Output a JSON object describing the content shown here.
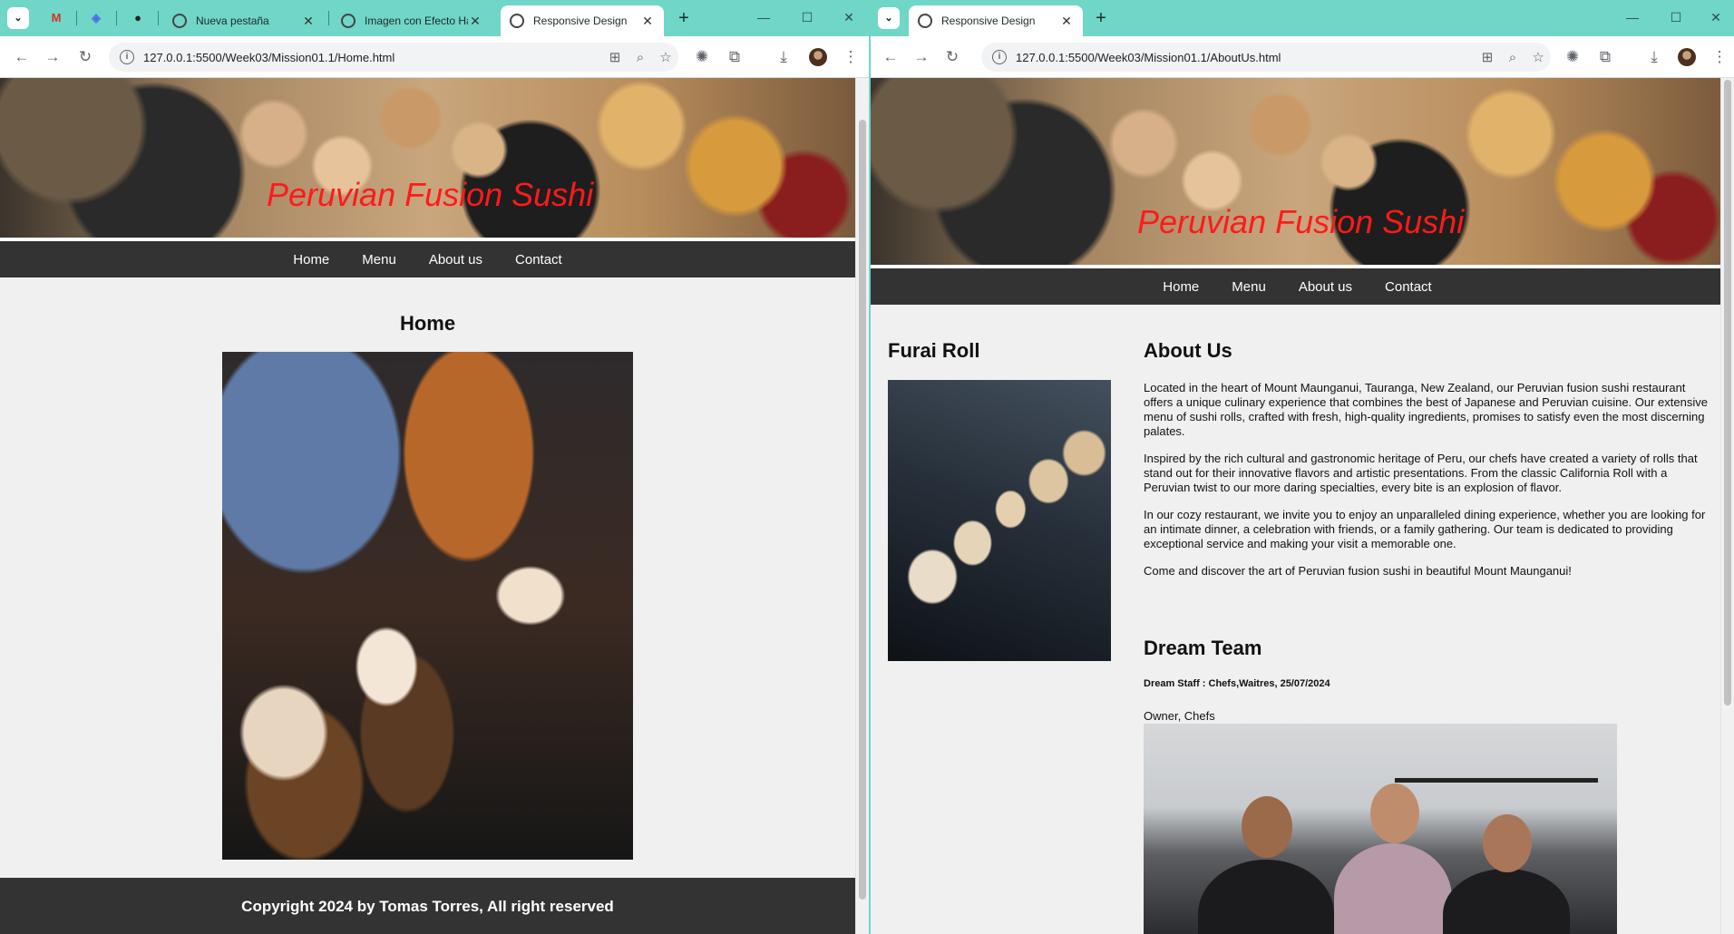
{
  "left": {
    "tabs": [
      {
        "title": "Nueva pestaña"
      },
      {
        "title": "Imagen con Efecto Ha"
      },
      {
        "title": "Responsive Design"
      }
    ],
    "url": "127.0.0.1:5500/Week03/Mission01.1/Home.html",
    "page": {
      "hero_title": "Peruvian Fusion Sushi",
      "nav": [
        "Home",
        "Menu",
        "About us",
        "Contact"
      ],
      "heading": "Home",
      "footer": "Copyright 2024 by Tomas Torres, All right reserved"
    }
  },
  "right": {
    "tabs": [
      {
        "title": "Responsive Design"
      }
    ],
    "url": "127.0.0.1:5500/Week03/Mission01.1/AboutUs.html",
    "page": {
      "hero_title": "Peruvian Fusion Sushi",
      "nav": [
        "Home",
        "Menu",
        "About us",
        "Contact"
      ],
      "side_heading": "Furai Roll",
      "about_heading": "About Us",
      "paragraphs": [
        "Located in the heart of Mount Maunganui, Tauranga, New Zealand, our Peruvian fusion sushi restaurant offers a unique culinary experience that combines the best of Japanese and Peruvian cuisine. Our extensive menu of sushi rolls, crafted with fresh, high-quality ingredients, promises to satisfy even the most discerning palates.",
        "Inspired by the rich cultural and gastronomic heritage of Peru, our chefs have created a variety of rolls that stand out for their innovative flavors and artistic presentations. From the classic California Roll with a Peruvian twist to our more daring specialties, every bite is an explosion of flavor.",
        "In our cozy restaurant, we invite you to enjoy an unparalleled dining experience, whether you are looking for an intimate dinner, a celebration with friends, or a family gathering. Our team is dedicated to providing exceptional service and making your visit a memorable one.",
        "Come and discover the art of Peruvian fusion sushi in beautiful Mount Maunganui!"
      ],
      "team_heading": "Dream Team",
      "team_subtitle": "Dream Staff : Chefs,Waitres, 25/07/2024",
      "team_caption": "Owner, Chefs"
    }
  },
  "colors": {
    "tabstrip": "#6fd6c8",
    "hero_title": "#ff1a1a",
    "nav_bg": "#333333",
    "page_bg": "#f0f0f0"
  },
  "icons": [
    "tab-search-icon",
    "gmail-icon",
    "drive-icon",
    "github-icon",
    "globe-icon",
    "close-icon",
    "plus-icon",
    "minimize-icon",
    "maximize-icon",
    "back-icon",
    "forward-icon",
    "reload-icon",
    "info-icon",
    "translate-icon",
    "zoom-icon",
    "star-icon",
    "extension-bug-icon",
    "puzzle-icon",
    "download-icon",
    "profile-avatar",
    "menu-dots-icon"
  ]
}
